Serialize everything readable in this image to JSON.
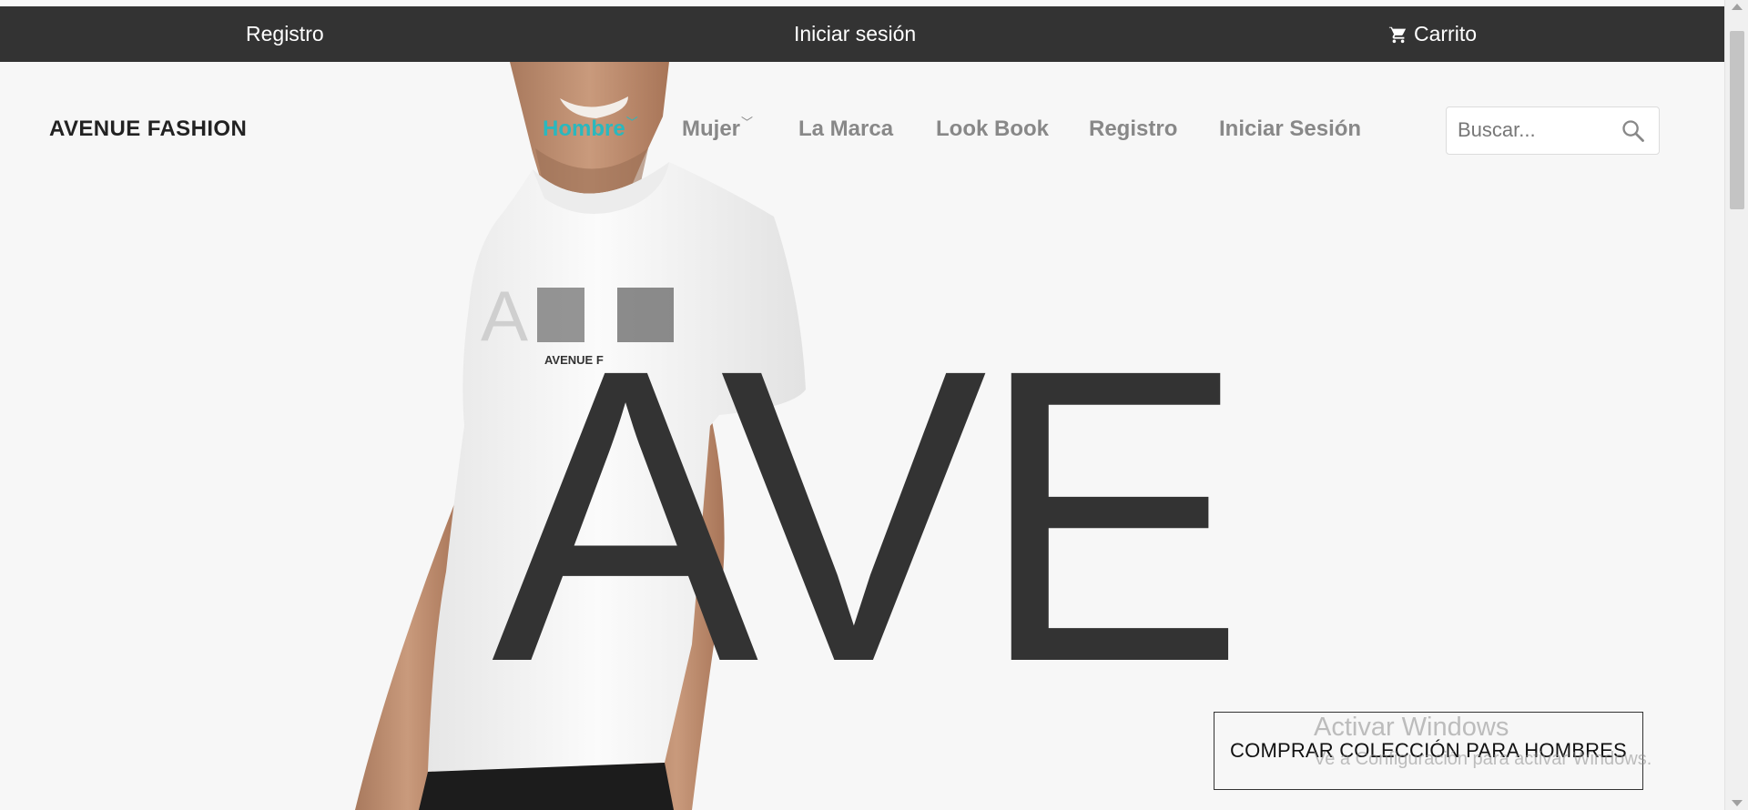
{
  "topbar": {
    "register": "Registro",
    "login": "Iniciar sesión",
    "cart": "Carrito",
    "background": "#333333"
  },
  "navbar": {
    "brand": "AVENUE FASHION",
    "items": [
      {
        "label": "Hombre",
        "active": true,
        "dropdown": true
      },
      {
        "label": "Mujer",
        "active": false,
        "dropdown": true
      },
      {
        "label": "La Marca",
        "active": false,
        "dropdown": false
      },
      {
        "label": "Look Book",
        "active": false,
        "dropdown": false
      },
      {
        "label": "Registro",
        "active": false,
        "dropdown": false
      },
      {
        "label": "Iniciar Sesión",
        "active": false,
        "dropdown": false
      }
    ],
    "active_color": "#2ab8be",
    "search_placeholder": "Buscar..."
  },
  "hero": {
    "title": "AVE",
    "shirt_print": "AVE",
    "shirt_brand": "AVENUE F",
    "cta": "COMPRAR COLECCIÓN PARA HOMBRES"
  },
  "watermark": {
    "line1": "Activar Windows",
    "line2": "Ve a Configuración para activar Windows."
  },
  "icons": {
    "cart": "cart-icon",
    "search": "search-icon",
    "dropdown": "chevron-down-icon"
  }
}
